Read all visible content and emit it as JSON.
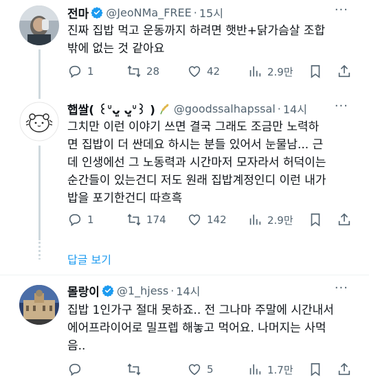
{
  "tweets": [
    {
      "name": "전마",
      "handle": "@JeoNMa_FREE",
      "time": "15시",
      "text": "진짜 집밥 먹고 운동까지 하려면 햇반+닭가슴살 조합\n밖에 없는 것 같아요",
      "stats": {
        "replies": "1",
        "retweets": "28",
        "likes": "42",
        "views": "2.9만"
      },
      "verified": true
    },
    {
      "name": "햅쌀( ꒰ᐡᴗ͈ ᴗ͈ᐡ꒱ )",
      "handle": "@goodssalhapssal",
      "time": "14시",
      "text": "그치만 이런 이야기 쓰면 결국 그래도 조금만 노력하\n면 집밥이 더 싼데요 하시는 분들 있어서 눈물남... 근\n데 인생에선 그 노동력과 시간마저 모자라서 허덕이는\n순간들이 있는건디 저도 원래 집밥계정인디 이런 내가\n밥을 포기한건디 따흐흑",
      "stats": {
        "replies": "1",
        "retweets": "174",
        "likes": "142",
        "views": "2.9만"
      },
      "verified": false
    },
    {
      "name": "몰랑이",
      "handle": "@1_hjess",
      "time": "14시",
      "text": "집밥 1인가구 절대 못하죠.. 전 그나마 주말에 시간내서\n에어프라이어로 밀프렙 해놓고 먹어요. 나머지는 사먹\n음..",
      "stats": {
        "replies": "",
        "retweets": "",
        "likes": "5",
        "views": "1.7만"
      },
      "verified": true
    }
  ],
  "show_replies_label": "답글 보기",
  "more_label": "···",
  "dot_separator": "·",
  "colors": {
    "accent": "#1d9bf0",
    "muted": "#536471",
    "text": "#0f1419",
    "thread_line": "#cfd9de"
  },
  "icons": [
    "reply-icon",
    "retweet-icon",
    "like-icon",
    "views-icon",
    "bookmark-icon",
    "share-icon",
    "verified-badge-icon",
    "rice-plant-icon"
  ]
}
